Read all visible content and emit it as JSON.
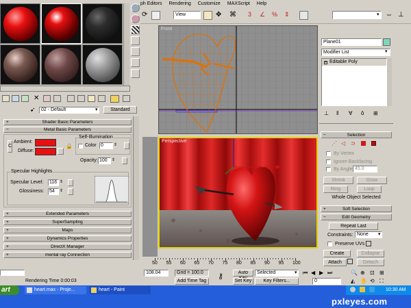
{
  "menu": [
    "ph Editors",
    "Rendering",
    "Customize",
    "MAXScript",
    "Help"
  ],
  "toolbar": {
    "view_select": "View"
  },
  "material_editor": {
    "material_name": "02 - Default",
    "material_type": "Standard",
    "rollouts_top": [
      "Shader Basic Parameters",
      "Metal Basic Parameters"
    ],
    "self_illum_title": "Self-Illumination",
    "ambient_label": "Ambient:",
    "diffuse_label": "Diffuse:",
    "color_label": "Color",
    "color_value": "0",
    "opacity_label": "Opacity:",
    "opacity_value": "100",
    "specular_title": "Specular Highlights",
    "spec_level_label": "Specular Level:",
    "spec_level_value": "116",
    "glossiness_label": "Glossiness:",
    "glossiness_value": "54",
    "rollouts_bottom": [
      "Extended Parameters",
      "SuperSampling",
      "Maps",
      "Dynamics Properties",
      "DirectX Manager",
      "mental ray Connection"
    ],
    "ambient_color": "#e81010",
    "diffuse_color": "#e81010"
  },
  "viewports": {
    "front_label": "Front",
    "persp_label": "Perspective"
  },
  "command_panel": {
    "object_name": "Plane01",
    "modifier_list": "Modifier List",
    "stack_item": "Editable Poly",
    "selection_title": "Selection",
    "by_vertex": "By Vertex",
    "ignore_backfacing": "Ignore Backfacing",
    "by_angle": "By Angle:",
    "angle_value": "45.0",
    "shrink": "Shrink",
    "grow": "Grow",
    "ring": "Ring",
    "loop": "Loop",
    "whole_object": "Whole Object Selected",
    "soft_selection": "Soft Selection",
    "edit_geometry": "Edit Geometry",
    "repeat_last": "Repeat Last",
    "constraints_label": "Constraints:",
    "constraints_value": "None",
    "preserve_uvs": "Preserve UVs",
    "create": "Create",
    "collapse": "Collapse",
    "attach": "Attach",
    "detach": "Detach"
  },
  "timeline_ticks": [
    "50",
    "55",
    "60",
    "65",
    "70",
    "75",
    "80",
    "85",
    "90",
    "95",
    "100"
  ],
  "status": {
    "rendering_time": "Rendering Time  0:00:03",
    "coord_value": "108.04",
    "grid": "Grid = 100.0",
    "add_time_tag": "Add Time Tag",
    "auto_key": "Auto Key",
    "auto_key_value": "Selected",
    "set_key": "Set Key",
    "key_filters": "Key Filters...",
    "frame_value": "0"
  },
  "taskbar": {
    "start": "art",
    "task1": "heart.max  - Proje...",
    "task2": "heart - Paint",
    "clock": "10:30 AM"
  },
  "watermark": "pxleyes.com"
}
